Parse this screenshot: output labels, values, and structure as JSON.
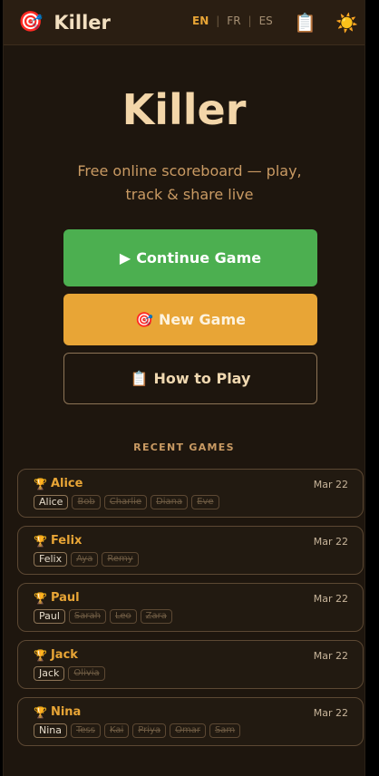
{
  "header": {
    "brand_icon": "🎯",
    "title": "Killer",
    "languages": [
      {
        "code": "EN",
        "active": true
      },
      {
        "code": "FR",
        "active": false
      },
      {
        "code": "ES",
        "active": false
      }
    ],
    "rules_icon": "📋",
    "theme_icon": "☀️"
  },
  "hero": {
    "title": "Killer",
    "subtitle": "Free online scoreboard — play, track & share live"
  },
  "actions": {
    "continue_icon": "▶",
    "continue_label": "Continue Game",
    "new_icon": "🎯",
    "new_label": "New Game",
    "howto_icon": "📋",
    "howto_label": "How to Play"
  },
  "recent": {
    "title": "RECENT GAMES",
    "trophy_icon": "🏆",
    "games": [
      {
        "winner": "Alice",
        "date": "Mar 22",
        "players": [
          "Alice",
          "Bob",
          "Charlie",
          "Diana",
          "Eve"
        ]
      },
      {
        "winner": "Felix",
        "date": "Mar 22",
        "players": [
          "Felix",
          "Aya",
          "Remy"
        ]
      },
      {
        "winner": "Paul",
        "date": "Mar 22",
        "players": [
          "Paul",
          "Sarah",
          "Leo",
          "Zara"
        ]
      },
      {
        "winner": "Jack",
        "date": "Mar 22",
        "players": [
          "Jack",
          "Olivia"
        ]
      },
      {
        "winner": "Nina",
        "date": "Mar 22",
        "players": [
          "Nina",
          "Tess",
          "Kai",
          "Priya",
          "Omar",
          "Sam"
        ]
      }
    ]
  },
  "colors": {
    "accent": "#e8a536",
    "success": "#4caf50",
    "background": "#1e160e"
  }
}
